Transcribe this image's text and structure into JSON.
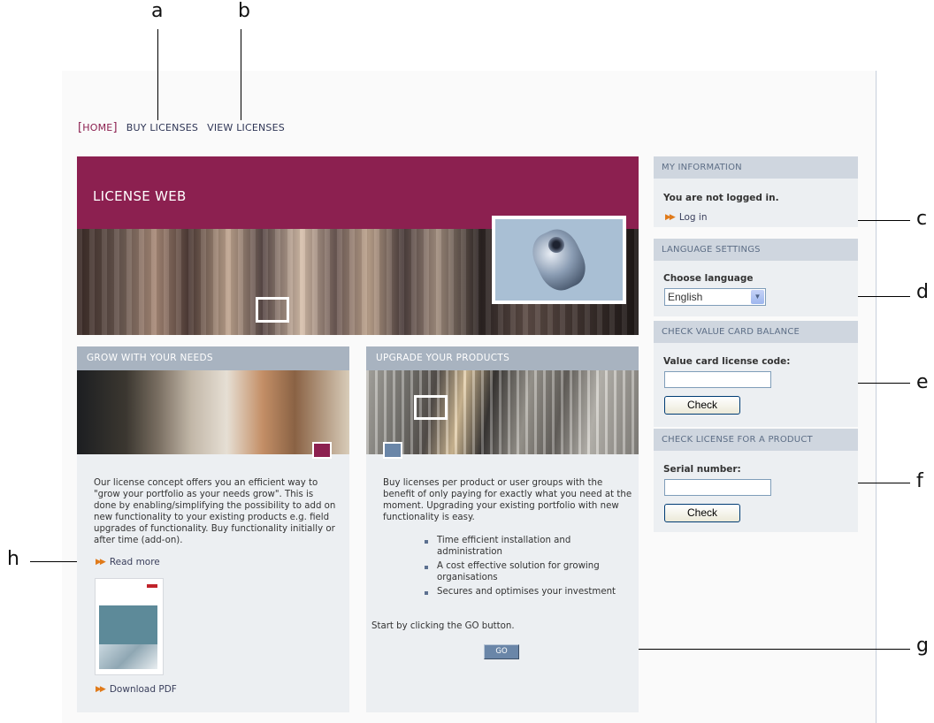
{
  "callouts": {
    "a": "a",
    "b": "b",
    "c": "c",
    "d": "d",
    "e": "e",
    "f": "f",
    "g": "g",
    "h": "h"
  },
  "nav": {
    "bracket_open": "[",
    "home": "HOME",
    "bracket_close": "]",
    "buy": "BUY LICENSES",
    "view": "VIEW LICENSES"
  },
  "banner": {
    "title": "LICENSE WEB"
  },
  "grow": {
    "title": "GROW WITH YOUR NEEDS",
    "text": "Our license concept offers you an efficient way to \"grow your portfolio as your needs grow\". This is done by enabling/simplifying the possibility to add on new functionality to your existing products e.g. field upgrades of functionality. Buy functionality initially or after time (add-on).",
    "read_more": "Read more",
    "download": "Download PDF"
  },
  "upgrade": {
    "title": "UPGRADE YOUR PRODUCTS",
    "text": "Buy licenses per product or user groups with the benefit of only paying for exactly what you need at the moment. Upgrading your existing portfolio with new functionality is easy.",
    "bullets": [
      "Time efficient installation and administration",
      "A cost effective solution for growing organisations",
      "Secures and optimises your investment"
    ],
    "start": "Start by clicking the GO button.",
    "go": "GO"
  },
  "my_info": {
    "title": "MY INFORMATION",
    "status": "You are not logged in.",
    "login": "Log in"
  },
  "language": {
    "title": "LANGUAGE SETTINGS",
    "label": "Choose language",
    "selected": "English"
  },
  "value_card": {
    "title": "CHECK VALUE CARD BALANCE",
    "label": "Value card license code:",
    "value": "",
    "check": "Check"
  },
  "check_license": {
    "title": "CHECK LICENSE FOR A PRODUCT",
    "label": "Serial number:",
    "value": "",
    "check": "Check"
  },
  "colors": {
    "brand": "#8c2050",
    "header_gray": "#a8b3c0",
    "panel": "#eceff2",
    "link_arrow": "#e07a1a",
    "button_blue": "#6a86a8"
  }
}
